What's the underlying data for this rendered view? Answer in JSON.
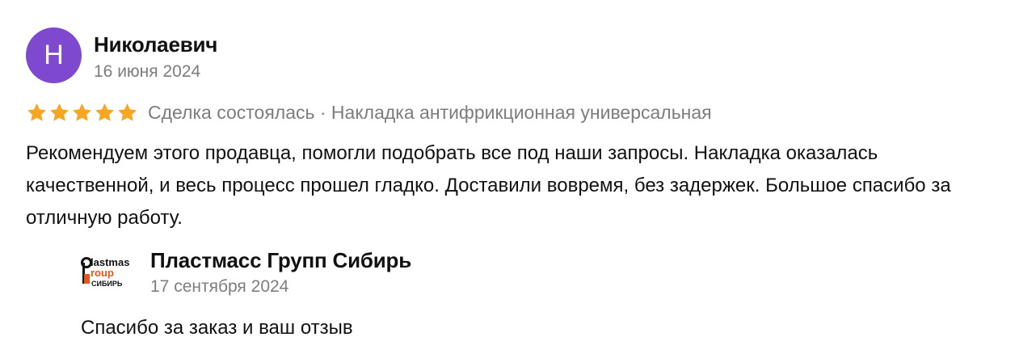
{
  "review": {
    "avatar_letter": "Н",
    "avatar_color": "#7e49cf",
    "author": "Николаевич",
    "date": "16 июня 2024",
    "rating": 5,
    "star_color": "#f6a623",
    "meta": "Сделка состоялась · Накладка антифрикционная универсальная",
    "text": "Рекомендуем этого продавца, помогли подобрать все под наши запросы. Накладка оказалась качественной, и весь процесс прошел гладко. Доставили вовремя, без задержек. Большое спасибо за отличную работу."
  },
  "reply": {
    "logo_text": {
      "line1": "lastmas",
      "line2": "roup",
      "line3": "СИБИРЬ"
    },
    "author": "Пластмасс Групп Сибирь",
    "date": "17 сентября 2024",
    "text": "Спасибо за заказ и ваш отзыв"
  }
}
